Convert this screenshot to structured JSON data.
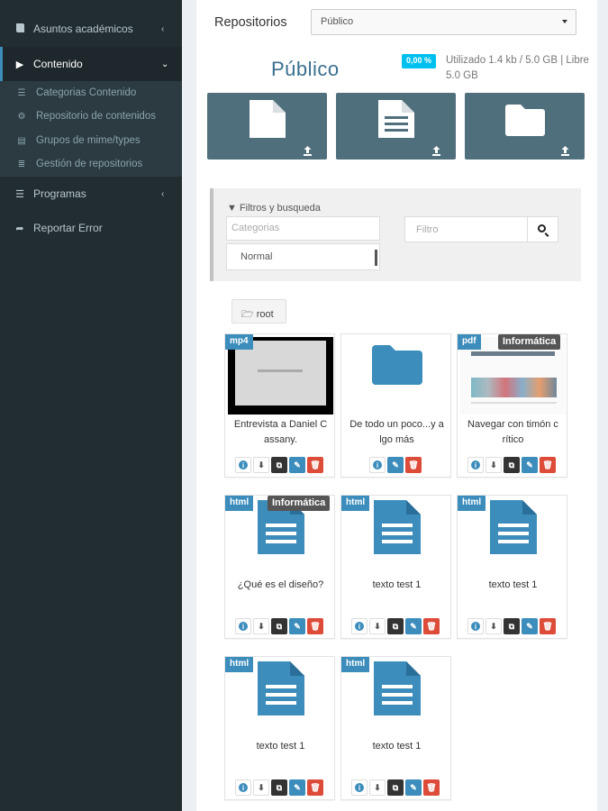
{
  "sidebar": {
    "items": [
      {
        "label": "Asuntos académicos",
        "icon": "book-icon"
      },
      {
        "label": "Contenido",
        "icon": "caret-right-icon"
      },
      {
        "label": "Programas",
        "icon": "list-icon"
      },
      {
        "label": "Reportar Error",
        "icon": "share-icon"
      }
    ],
    "sub_items": [
      {
        "label": "Categorias Contenido",
        "icon": "list-icon"
      },
      {
        "label": "Repositorio de contenidos",
        "icon": "gear-icon"
      },
      {
        "label": "Grupos de mime/types",
        "icon": "file-icon"
      },
      {
        "label": "Gestión de repositorios",
        "icon": "database-icon"
      }
    ]
  },
  "header": {
    "repo_label": "Repositorios",
    "repo_select_value": "Público",
    "title": "Público",
    "usage_badge": "0,00 %",
    "usage_text": "Utilizado 1.4 kb / 5.0 GB | Libre 5.0 GB"
  },
  "filters": {
    "title": "Filtros y busqueda",
    "category_placeholder": "Categorias",
    "type_select_value": "Normal",
    "search_placeholder": "Filtro"
  },
  "root_button": "root",
  "cards": [
    {
      "type": "mp4",
      "category": "",
      "title": "Entrevista a Daniel C assany."
    },
    {
      "type": "",
      "category": "",
      "title": "De todo un poco...y a lgo más"
    },
    {
      "type": "pdf",
      "category": "Informática",
      "title": "Navegar con timón c rítico"
    },
    {
      "type": "html",
      "category": "Informática",
      "title": "¿Qué es el diseño?"
    },
    {
      "type": "html",
      "category": "",
      "title": "texto test 1"
    },
    {
      "type": "html",
      "category": "",
      "title": "texto test 1"
    },
    {
      "type": "html",
      "category": "",
      "title": "texto test 1"
    },
    {
      "type": "html",
      "category": "",
      "title": "texto test 1"
    }
  ],
  "action_glyphs": {
    "info": "i",
    "download": "⬇",
    "copy": "⧉",
    "edit": "✎",
    "delete": "🗑"
  },
  "colors": {
    "sidebar": "#222d32",
    "accent": "#3c8dbc",
    "danger": "#dd4b39",
    "tile": "#506f7c",
    "info_badge": "#00c0ef"
  }
}
